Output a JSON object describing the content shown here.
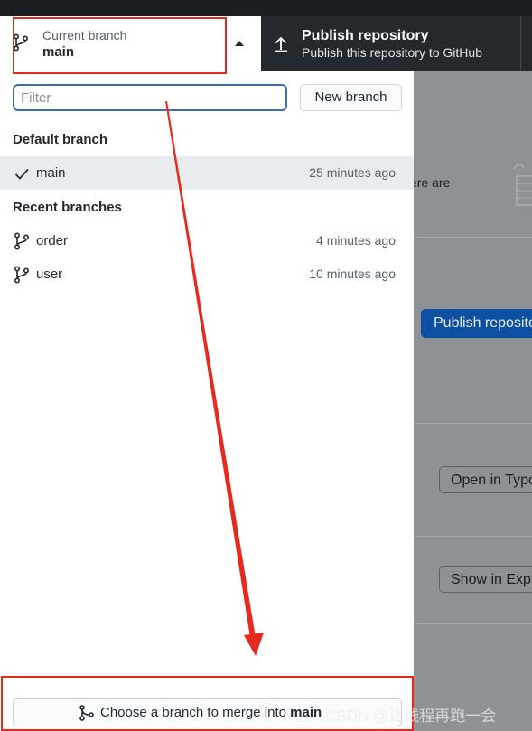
{
  "toolbar": {
    "current_branch": {
      "label": "Current branch",
      "name": "main"
    },
    "publish": {
      "title": "Publish repository",
      "description": "Publish this repository to GitHub"
    }
  },
  "dropdown": {
    "filter": {
      "placeholder": "Filter",
      "value": ""
    },
    "new_branch_label": "New branch",
    "default_section": "Default branch",
    "default_branches": [
      {
        "name": "main",
        "time": "25 minutes ago",
        "selected": true,
        "icon": "check-icon"
      }
    ],
    "recent_section": "Recent branches",
    "recent_branches": [
      {
        "name": "order",
        "time": "4 minutes ago",
        "icon": "branch-icon"
      },
      {
        "name": "user",
        "time": "10 minutes ago",
        "icon": "branch-icon"
      }
    ],
    "merge": {
      "prefix": "Choose a branch to merge into",
      "branch": "main"
    }
  },
  "background": {
    "partial_text": "ere are",
    "publish_button": "Publish reposito",
    "open_in_button": "Open in Typo",
    "show_in_button": "Show in Explo"
  },
  "watermark": "CSDN @让线程再跑一会",
  "colors": {
    "annotation": "#e6281d",
    "toolbar_bg": "#24292e",
    "selected_row": "#e9ecef",
    "focus_border": "#3b6fb5",
    "primary_button": "#0d4fa1"
  }
}
